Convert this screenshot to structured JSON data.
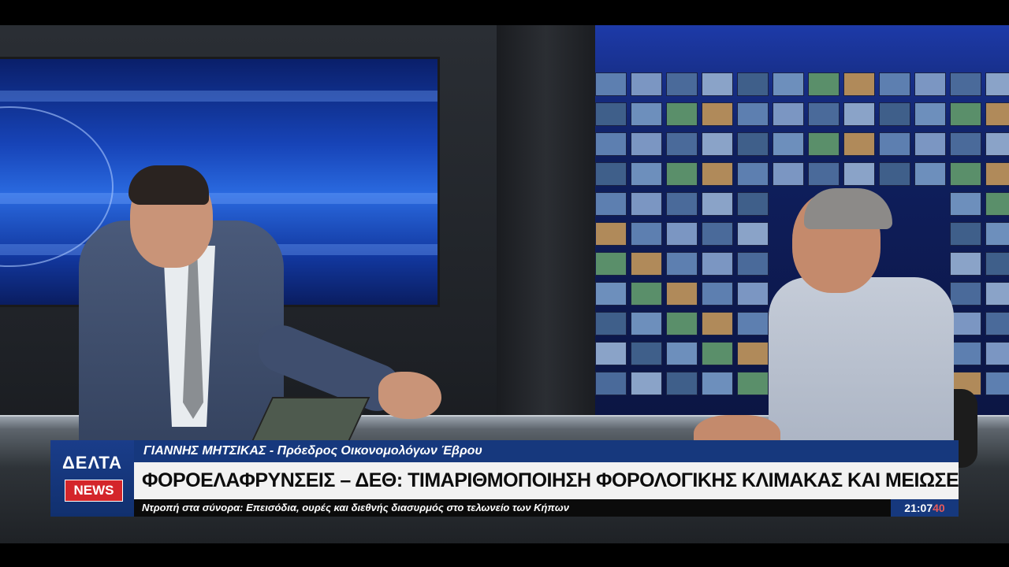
{
  "brand": {
    "logo_line1": "ΔΕΛΤΑ",
    "logo_line2": "NEWS",
    "primary_color": "#16387d",
    "accent_color": "#d4252a"
  },
  "lower_third": {
    "name_line": "ΓΙΑΝΝΗΣ ΜΗΤΣΙΚΑΣ - Πρόεδρος Οικονομολόγων Έβρου",
    "headline": "ΦΟΡΟΕΛΑΦΡΥΝΣΕΙΣ – ΔΕΘ: ΤΙΜΑΡΙΘΜΟΠΟΙΗΣΗ ΦΟΡΟΛΟΓΙΚΗΣ ΚΛΙΜΑΚΑΣ ΚΑΙ ΜΕΙΩΣΕΙΣ ΣΥΝΤΕΛΕΣΤΩΝ",
    "ticker": "Ντροπή στα σύνορα: Επεισόδια, ουρές και διεθνής διασυρμός στο τελωνείο των Κήπων",
    "clock_hm": "21:07",
    "clock_s": "40"
  }
}
